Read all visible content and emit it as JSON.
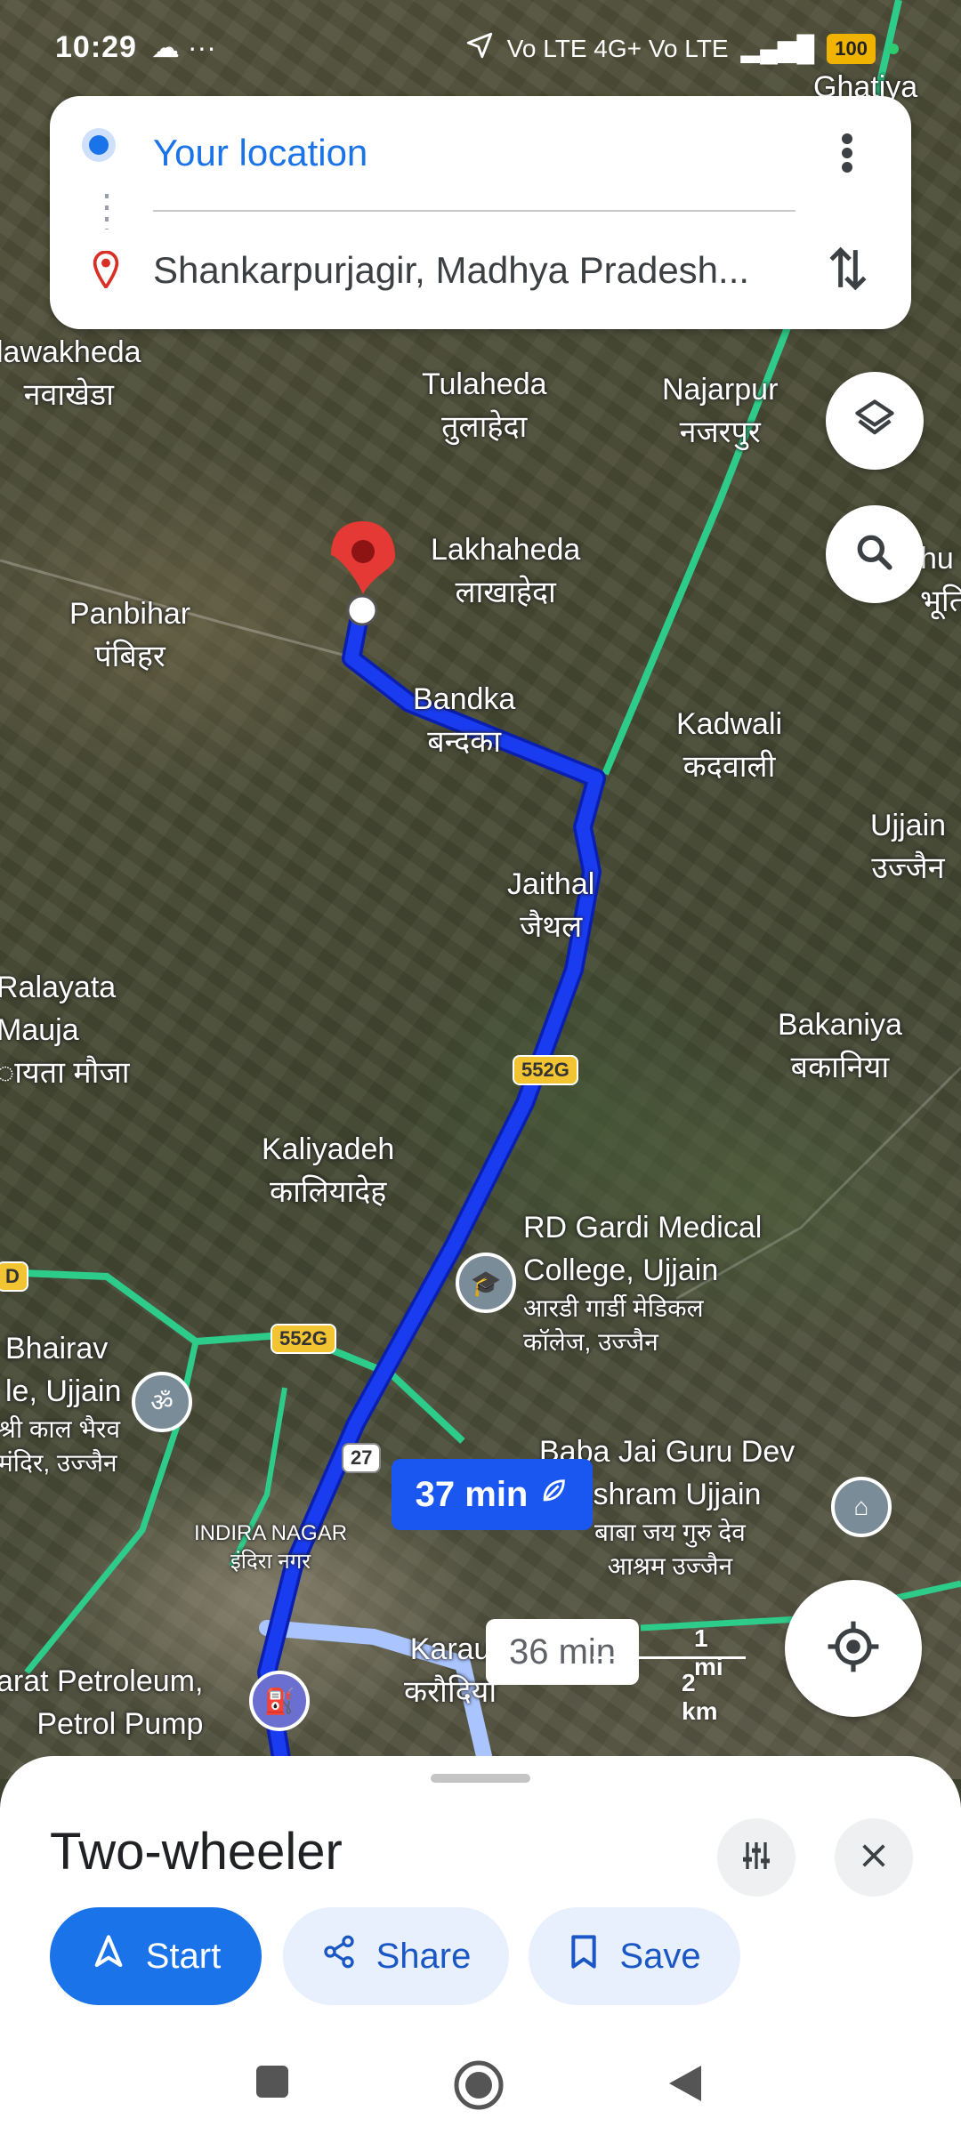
{
  "status_bar": {
    "time": "10:29",
    "extra": "☁ ···",
    "network": "Vo LTE 4G+ Vo LTE",
    "battery": "100"
  },
  "directions": {
    "origin": "Your location",
    "destination": "Shankarpurjagir, Madhya Pradesh..."
  },
  "map": {
    "labels": [
      {
        "id": "ghatiya",
        "text": "Ghatiya"
      },
      {
        "id": "nawakheda",
        "text": "lawakheda\nनवाखेडा"
      },
      {
        "id": "tulaheda",
        "text": "Tulaheda\nतुलाहेदा"
      },
      {
        "id": "najarpur",
        "text": "Najarpur\nनजरपुर"
      },
      {
        "id": "lakhaheda",
        "text": "Lakhaheda\nलाखाहेदा"
      },
      {
        "id": "panbihar",
        "text": "Panbihar\nपंबिहर"
      },
      {
        "id": "bandka",
        "text": "Bandka\nबन्दका"
      },
      {
        "id": "kadwali",
        "text": "Kadwali\nकदवाली"
      },
      {
        "id": "ujjain",
        "text": "Ujjain\nउज्जैन"
      },
      {
        "id": "jaithal",
        "text": "Jaithal\nजैथल"
      },
      {
        "id": "ralayata",
        "text": "Ralayata\nMauja\nायता मौजा"
      },
      {
        "id": "bakaniya",
        "text": "Bakaniya\nबकानिया"
      },
      {
        "id": "kaliyadeh",
        "text": "Kaliyadeh\nकालियादेह"
      },
      {
        "id": "rdgardi",
        "text": "RD Gardi Medical\nCollege, Ujjain"
      },
      {
        "id": "rdgardi_hi",
        "text": "आरडी गार्डी मेडिकल\nकॉलेज, उज्जैन"
      },
      {
        "id": "bhairav",
        "text": "Bhairav\nle, Ujjain"
      },
      {
        "id": "bhairav_hi",
        "text": "श्री काल भैरव\nमंदिर, उज्जैन"
      },
      {
        "id": "babajai",
        "text": "Baba Jai Guru Dev\nAshram Ujjain"
      },
      {
        "id": "babajai_hi",
        "text": "बाबा जय गुरु देव\nआश्रम उज्जैन"
      },
      {
        "id": "indiranagar",
        "text": "INDIRA NAGAR\nइंदिरा नगर"
      },
      {
        "id": "bharat",
        "text": "arat Petroleum,\nPetrol Pump"
      },
      {
        "id": "karaudiya",
        "text": "Karau\nकरौदिया"
      },
      {
        "id": "bhu",
        "text": "hu\nभूति"
      }
    ],
    "shields": {
      "s1": "552G",
      "s2": "552G",
      "s3": "27",
      "s4": "D"
    },
    "route_time": "37 min",
    "alt_route_time": "36 min",
    "scale": {
      "miles": "1 mi",
      "km": "2 km"
    }
  },
  "sheet": {
    "mode": "Two-wheeler",
    "start_label": "Start",
    "share_label": "Share",
    "save_label": "Save"
  },
  "colors": {
    "route": "#1a3cf0",
    "alt_route": "#a9c4ff",
    "highway": "#2ecc8a",
    "accent": "#1a73e8"
  }
}
